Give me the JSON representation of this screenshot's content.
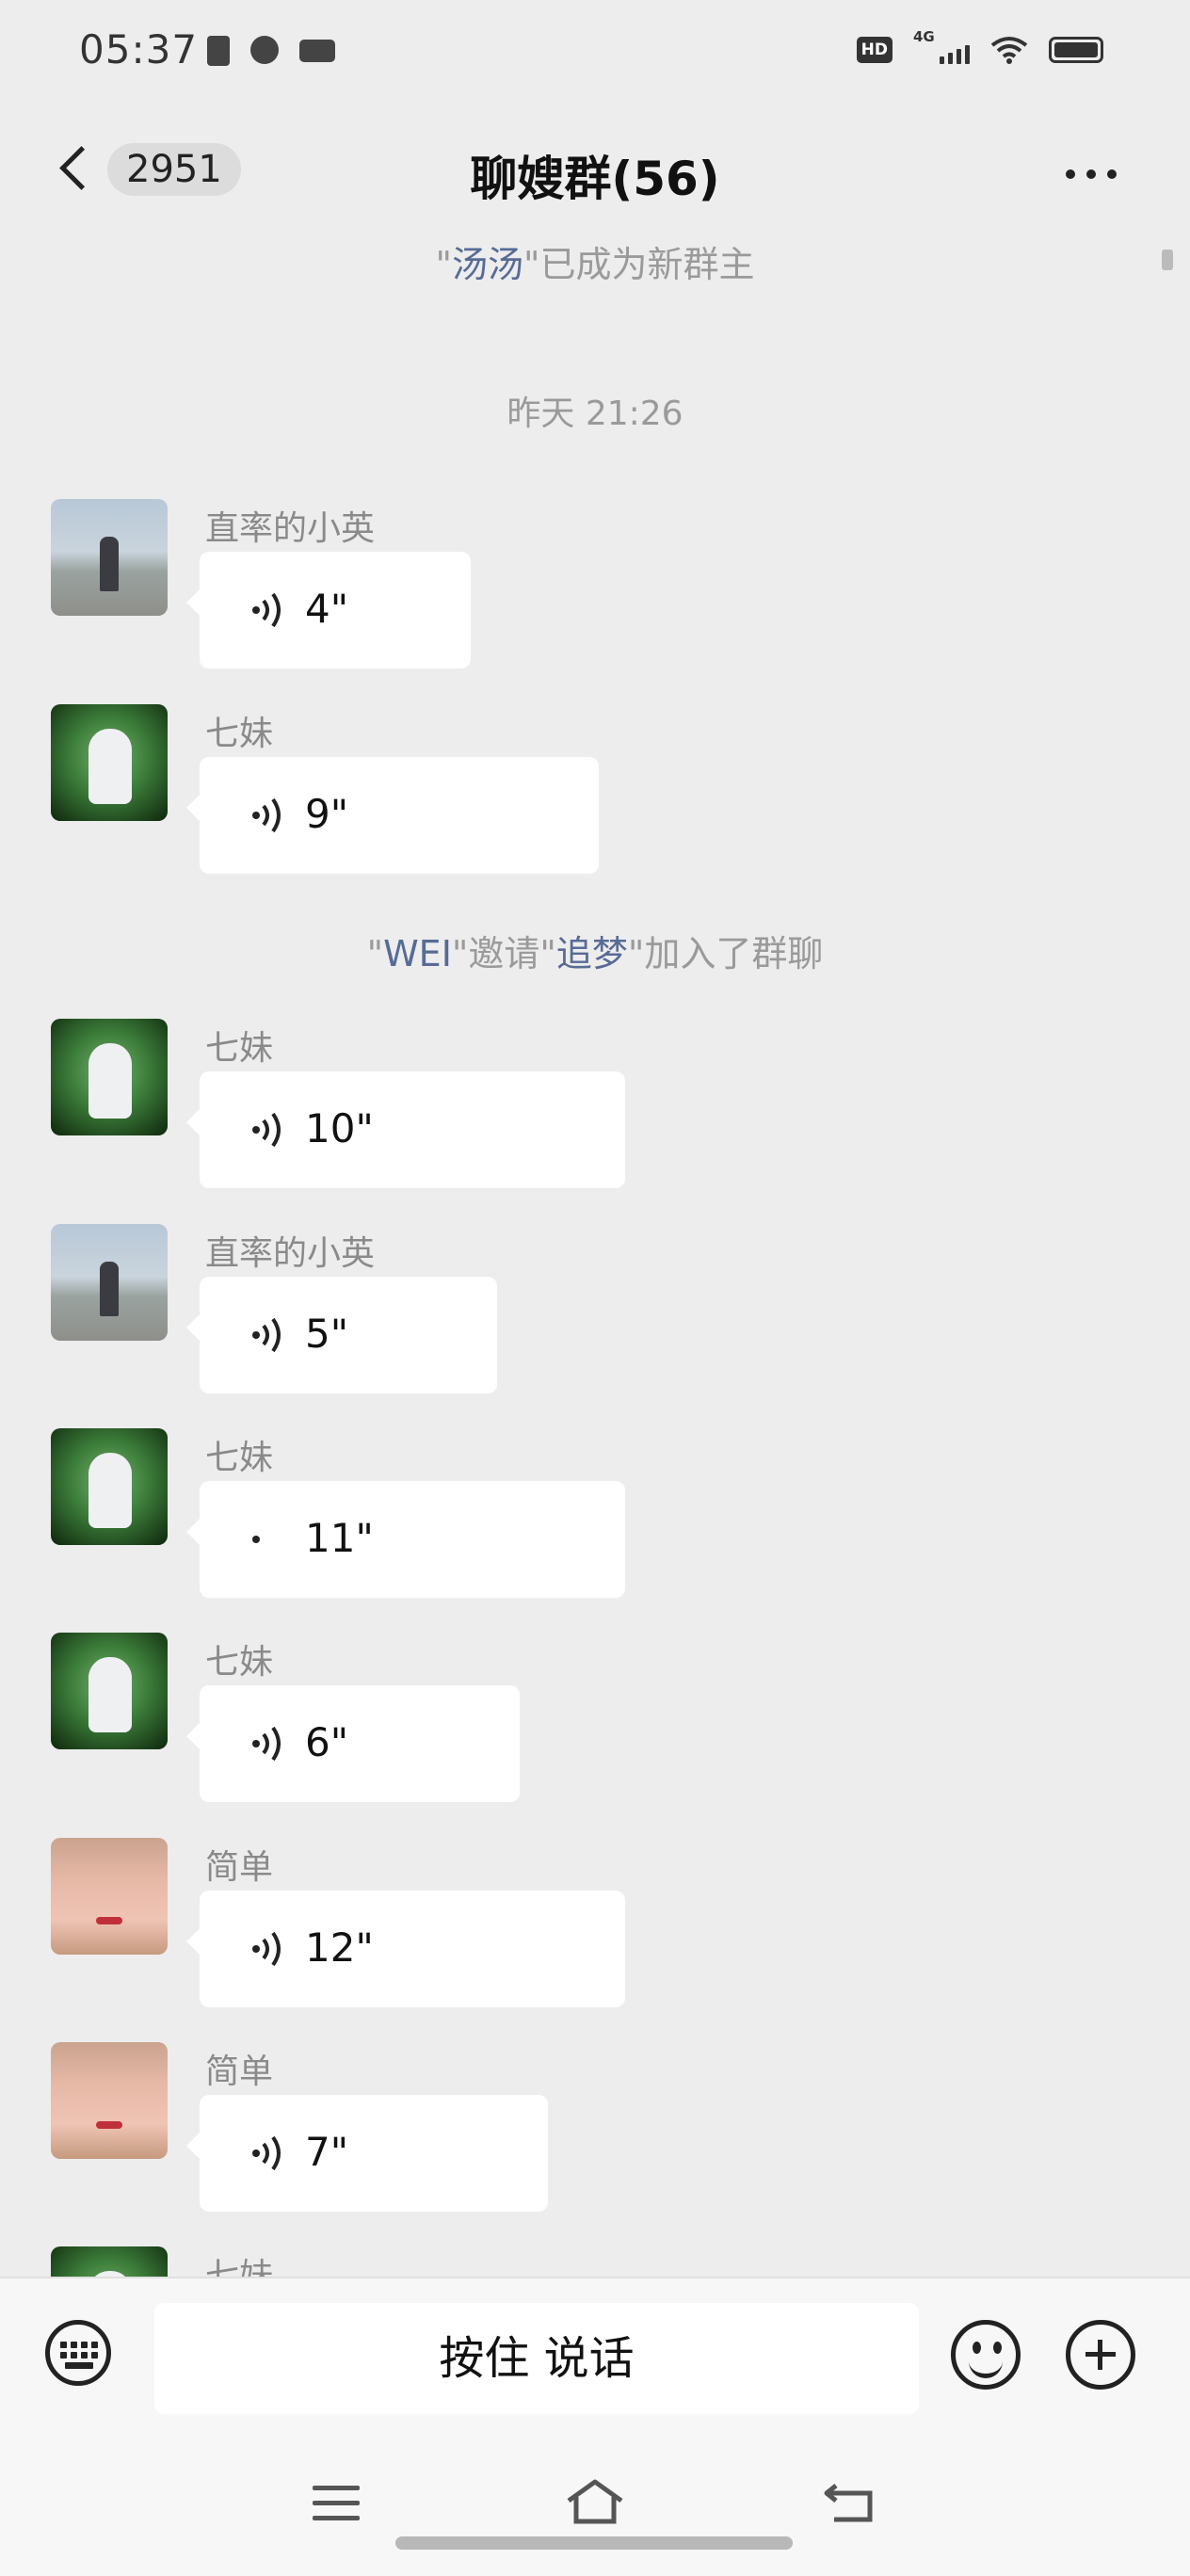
{
  "status_bar": {
    "time": "05:37",
    "left_icons": [
      "clipboard-icon",
      "wechat-icon",
      "video-camera-icon"
    ],
    "hd_badge": "HD",
    "network": "4G",
    "right_icons": [
      "signal-icon",
      "wifi-icon",
      "battery-icon"
    ]
  },
  "header": {
    "unread_count": "2951",
    "title": "聊嫂群(56)"
  },
  "system_messages": {
    "new_owner": {
      "quote_open": "\"",
      "name": "汤汤",
      "text": "\"已成为新群主"
    },
    "timestamp": "昨天 21:26",
    "invite": {
      "q1": "\"",
      "inviter": "WEI",
      "mid": "\"邀请\"",
      "invitee": "追梦",
      "tail": "\"加入了群聊"
    }
  },
  "messages": [
    {
      "sender": "直率的小英",
      "duration": "4\"",
      "type": "voice"
    },
    {
      "sender": "七妹",
      "duration": "9\"",
      "type": "voice"
    },
    {
      "sender": "七妹",
      "duration": "10\"",
      "type": "voice"
    },
    {
      "sender": "直率的小英",
      "duration": "5\"",
      "type": "voice"
    },
    {
      "sender": "七妹",
      "duration": "11\"",
      "type": "voice"
    },
    {
      "sender": "七妹",
      "duration": "6\"",
      "type": "voice"
    },
    {
      "sender": "简单",
      "duration": "12\"",
      "type": "voice"
    },
    {
      "sender": "简单",
      "duration": "7\"",
      "type": "voice"
    },
    {
      "sender": "七妹",
      "type": "partial"
    }
  ],
  "input_bar": {
    "hold_to_talk": "按住 说话"
  },
  "colors": {
    "background": "#ededed",
    "bubble": "#ffffff",
    "link": "#576b95",
    "system_text": "#9a9a9a"
  }
}
